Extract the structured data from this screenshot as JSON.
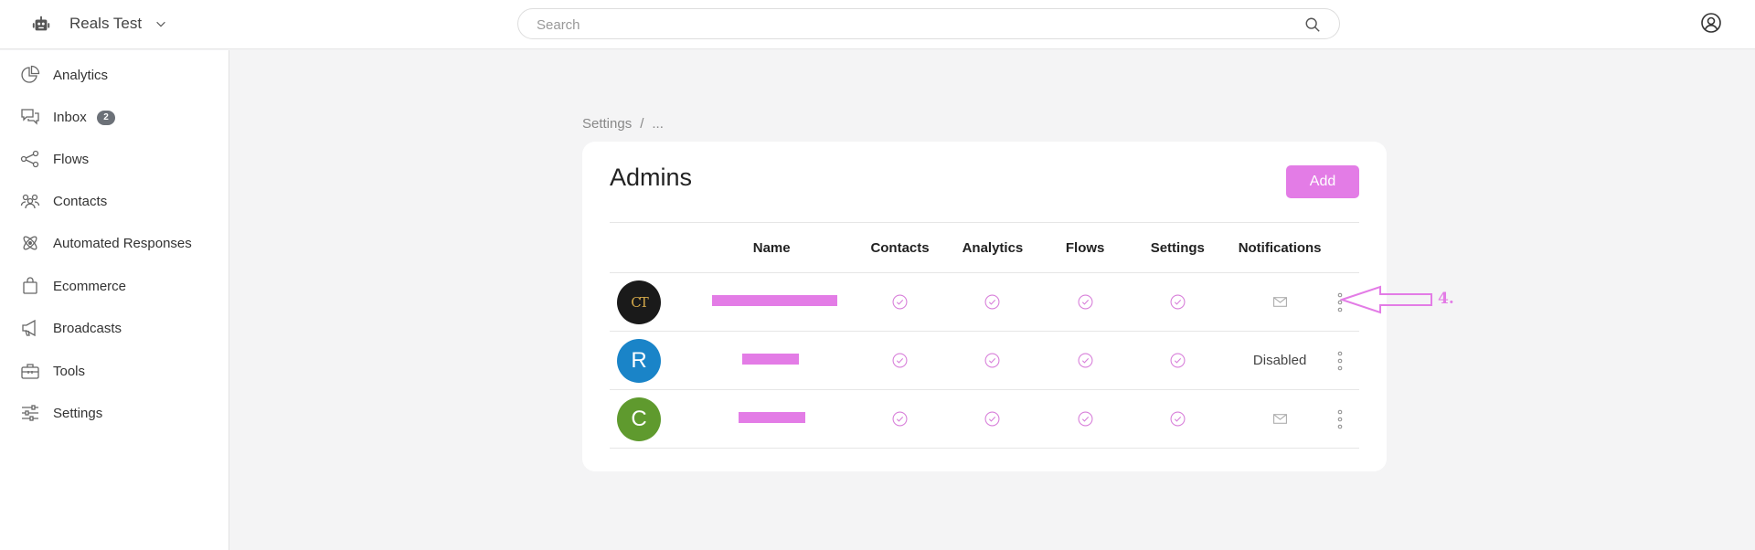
{
  "topbar": {
    "workspace_name": "Reals Test",
    "search_placeholder": "Search"
  },
  "sidebar": {
    "items": [
      {
        "label": "Analytics",
        "icon": "pie-chart-icon"
      },
      {
        "label": "Inbox",
        "icon": "chat-bubbles-icon",
        "badge": "2"
      },
      {
        "label": "Flows",
        "icon": "flow-nodes-icon"
      },
      {
        "label": "Contacts",
        "icon": "people-icon"
      },
      {
        "label": "Automated Responses",
        "icon": "atom-icon"
      },
      {
        "label": "Ecommerce",
        "icon": "shopping-bag-icon"
      },
      {
        "label": "Broadcasts",
        "icon": "megaphone-icon"
      },
      {
        "label": "Tools",
        "icon": "toolbox-icon"
      },
      {
        "label": "Settings",
        "icon": "sliders-icon"
      }
    ]
  },
  "breadcrumb": {
    "root": "Settings",
    "separator": "/",
    "current": "..."
  },
  "card": {
    "title": "Admins",
    "add_label": "Add"
  },
  "table": {
    "columns": [
      "",
      "Name",
      "Contacts",
      "Analytics",
      "Flows",
      "Settings",
      "Notifications",
      ""
    ],
    "rows": [
      {
        "avatar_text": "CT",
        "avatar_color": "#1a1a1a",
        "notifications": "mail-icon"
      },
      {
        "avatar_text": "R",
        "avatar_color": "#1a84c8",
        "notifications": "Disabled"
      },
      {
        "avatar_text": "C",
        "avatar_color": "#5f9a2e",
        "notifications": "mail-icon"
      }
    ]
  },
  "annotation": {
    "label": "4."
  },
  "colors": {
    "accent": "#e37ce6",
    "check": "#d77dd9"
  }
}
